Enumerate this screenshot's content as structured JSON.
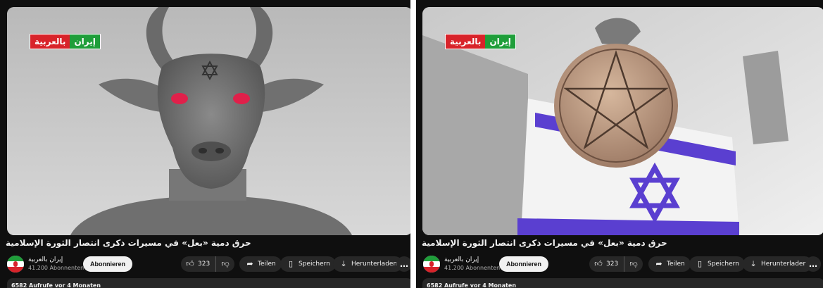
{
  "panels": [
    {
      "logo": {
        "red_text": "بالعربية",
        "green_text": "إيران"
      },
      "title": "حرق دمية «بعل» في مسيرات ذكرى انتصار الثورة الإسلامية",
      "channel": {
        "name": "إيران بالعربية",
        "subscribers": "41.200 Abonnenten"
      },
      "subscribe_label": "Abonnieren",
      "like_count": "323",
      "share_label": "Teilen",
      "save_label": "Speichern",
      "download_label": "Herunterladen",
      "more_label": "…",
      "views_text": "6582 Aufrufe vor 4 Monaten"
    },
    {
      "logo": {
        "red_text": "بالعربية",
        "green_text": "إيران"
      },
      "title": "حرق دمية «بعل» في مسيرات ذكرى انتصار الثورة الإسلامية",
      "channel": {
        "name": "إيران بالعربية",
        "subscribers": "41.200 Abonnenten"
      },
      "subscribe_label": "Abonnieren",
      "like_count": "323",
      "share_label": "Teilen",
      "save_label": "Speichern",
      "download_label": "Herunterladen",
      "more_label": "…",
      "views_text": "6582 Aufrufe vor 4 Monaten"
    }
  ],
  "icons": {
    "like": "thumb-up-icon",
    "dislike": "thumb-down-icon",
    "share": "share-arrow-icon",
    "save": "bookmark-icon",
    "download": "download-icon",
    "more": "more-horizontal-icon"
  },
  "colors": {
    "background": "#0f0f0f",
    "pill": "#272727",
    "subscribe_bg": "#f1f1f1",
    "logo_red": "#d8232a",
    "logo_green": "#1f9e3a",
    "flag_blue": "#5a3fd0",
    "eye_red": "#e0204a"
  }
}
